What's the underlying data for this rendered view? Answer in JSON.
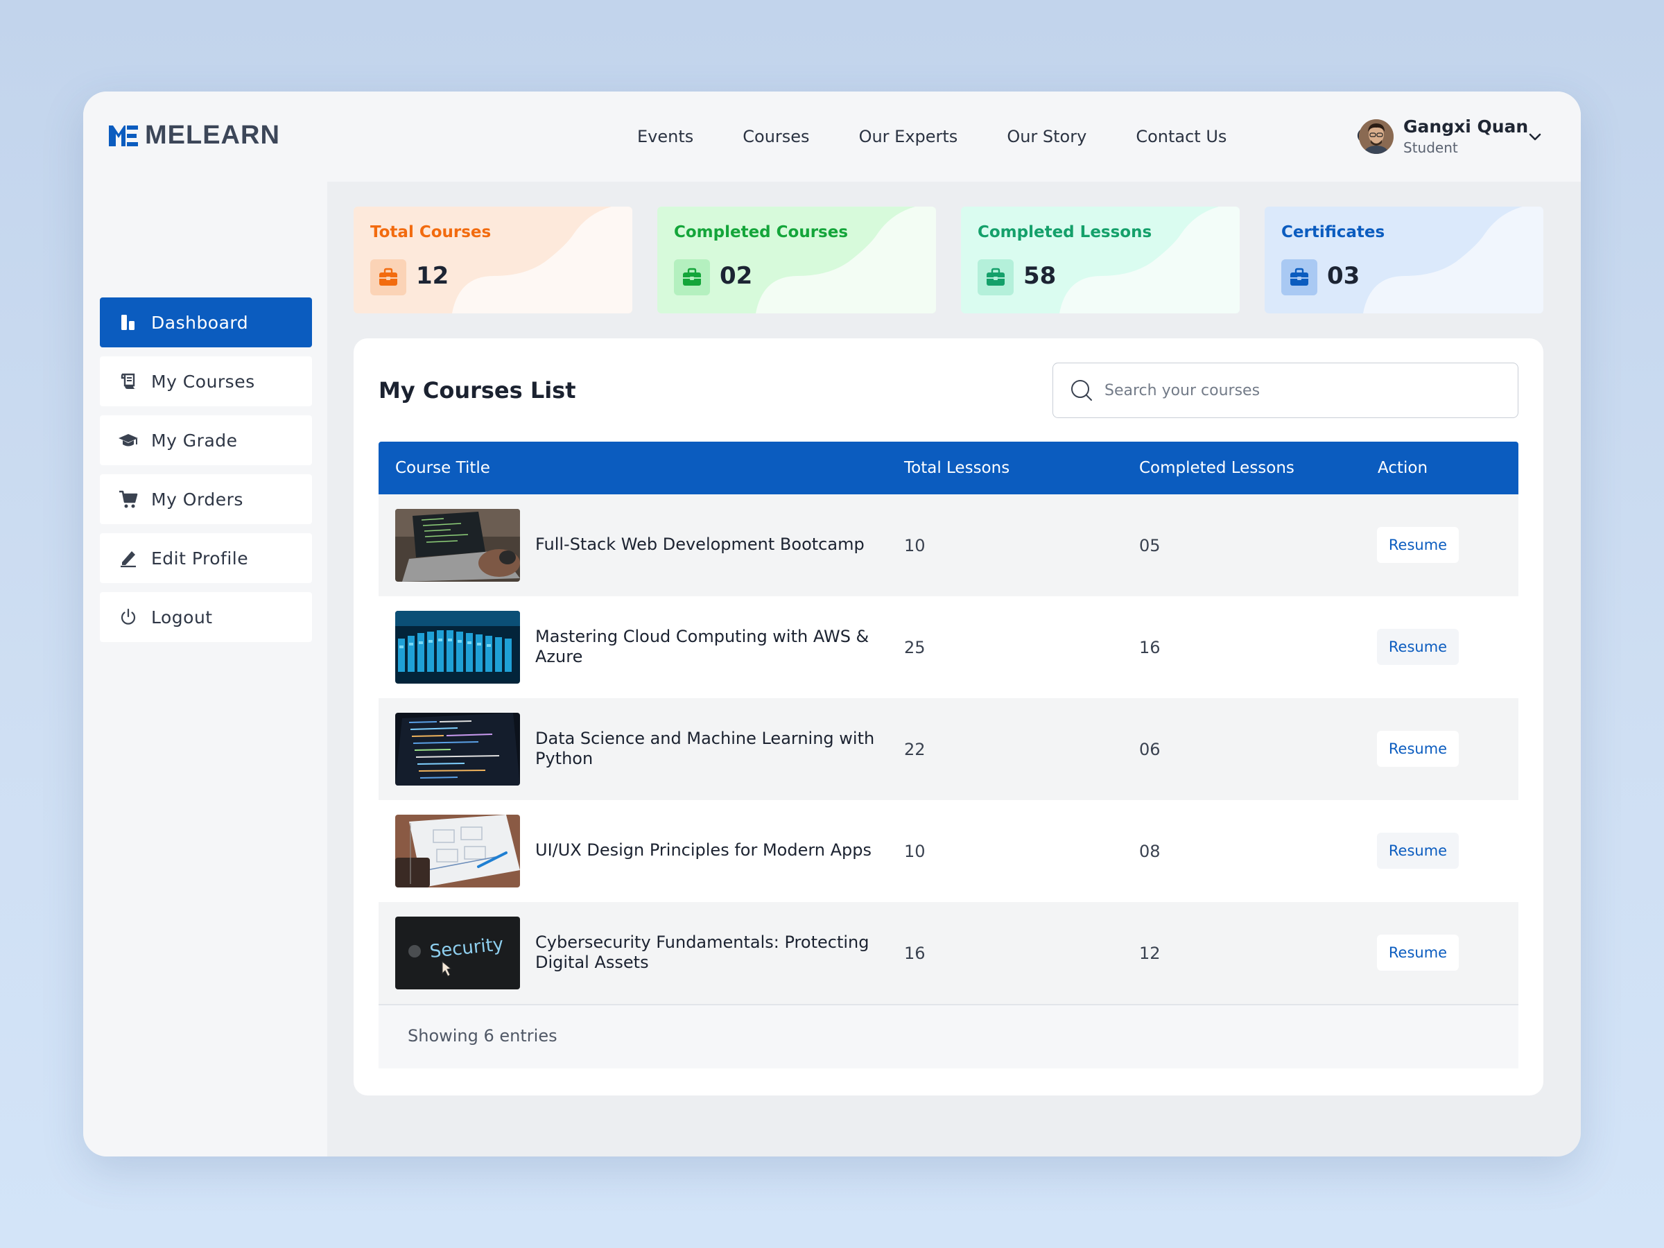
{
  "app": {
    "brand": "MELEARN",
    "brand_color": "#0b5cbf"
  },
  "nav": {
    "items": [
      "Events",
      "Courses",
      "Our Experts",
      "Our Story",
      "Contact Us"
    ]
  },
  "user": {
    "name": "Gangxi Quan",
    "role": "Student"
  },
  "sidebar": {
    "items": [
      {
        "label": "Dashboard",
        "icon": "dashboard-icon",
        "active": true
      },
      {
        "label": "My Courses",
        "icon": "scroll-icon"
      },
      {
        "label": "My Grade",
        "icon": "graduation-cap-icon"
      },
      {
        "label": "My Orders",
        "icon": "cart-icon"
      },
      {
        "label": "Edit Profile",
        "icon": "pencil-icon"
      },
      {
        "label": "Logout",
        "icon": "power-icon"
      }
    ]
  },
  "stats": [
    {
      "title": "Total Courses",
      "value": "12",
      "color": "#f26b0f",
      "bg": "#fde9db",
      "icon": "briefcase-icon"
    },
    {
      "title": "Completed Courses",
      "value": "02",
      "color": "#14a53a",
      "bg": "#d7fadb",
      "icon": "briefcase-icon"
    },
    {
      "title": "Completed Lessons",
      "value": "58",
      "color": "#14a06a",
      "bg": "#dafcf0",
      "icon": "briefcase-icon"
    },
    {
      "title": "Certificates",
      "value": "03",
      "color": "#0b5cbf",
      "bg": "#dbe9fb",
      "icon": "briefcase-icon"
    }
  ],
  "courses_list": {
    "title": "My Courses List",
    "search_placeholder": "Search your courses",
    "columns": [
      "Course Title",
      "Total Lessons",
      "Completed Lessons",
      "Action"
    ],
    "rows": [
      {
        "title": "Full-Stack Web Development Bootcamp",
        "total": "10",
        "completed": "05",
        "action": "Resume"
      },
      {
        "title": "Mastering Cloud Computing with AWS & Azure",
        "total": "25",
        "completed": "16",
        "action": "Resume"
      },
      {
        "title": "Data Science and Machine Learning with Python",
        "total": "22",
        "completed": "06",
        "action": "Resume"
      },
      {
        "title": "UI/UX Design Principles for Modern Apps",
        "total": "10",
        "completed": "08",
        "action": "Resume"
      },
      {
        "title": "Cybersecurity Fundamentals: Protecting Digital Assets",
        "total": "16",
        "completed": "12",
        "action": "Resume"
      }
    ],
    "thumb_text_security": "Security",
    "footer": "Showing 6 entries"
  }
}
